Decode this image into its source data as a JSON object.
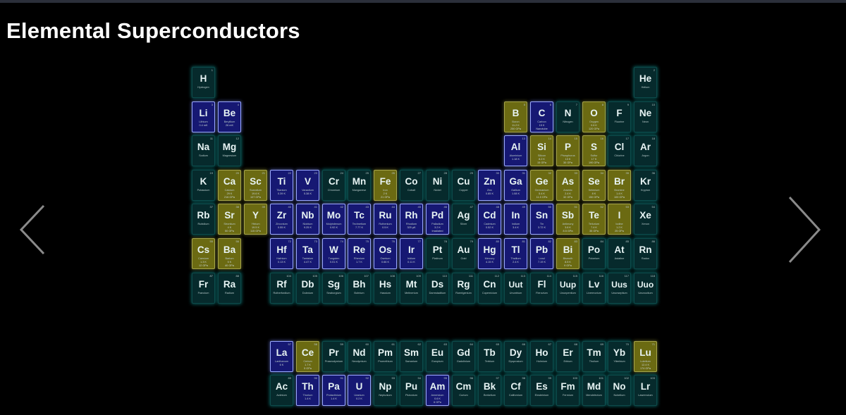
{
  "page": {
    "title": "Elemental Superconductors"
  },
  "nav": {
    "prev_icon": "chevron-left-icon",
    "next_icon": "chevron-right-icon"
  },
  "legend_colors": {
    "normal": "#062a2c",
    "superconductor_ambient": "#161873",
    "superconductor_pressure": "#6b6a12"
  },
  "elements": [
    {
      "n": 1,
      "s": "H",
      "name": "Hydrogen",
      "t": "normal",
      "row": 1,
      "col": 1
    },
    {
      "n": 2,
      "s": "He",
      "name": "Helium",
      "t": "normal",
      "row": 1,
      "col": 18
    },
    {
      "n": 3,
      "s": "Li",
      "name": "Lithium",
      "t": "blue",
      "tc": "0.4 mK",
      "row": 2,
      "col": 1
    },
    {
      "n": 4,
      "s": "Be",
      "name": "Beryllium",
      "t": "blue",
      "tc": "26 mK",
      "row": 2,
      "col": 2
    },
    {
      "n": 5,
      "s": "B",
      "name": "Boron",
      "t": "gold",
      "tc": "11.2 K",
      "p": "250 GPa",
      "row": 2,
      "col": 13
    },
    {
      "n": 6,
      "s": "C",
      "name": "Carbon",
      "t": "blue",
      "tc": "15 K",
      "p": "Nanotube",
      "row": 2,
      "col": 14
    },
    {
      "n": 7,
      "s": "N",
      "name": "Nitrogen",
      "t": "normal",
      "row": 2,
      "col": 15
    },
    {
      "n": 8,
      "s": "O",
      "name": "Oxygen",
      "t": "gold",
      "tc": "0.6 K",
      "p": "120 GPa",
      "row": 2,
      "col": 16
    },
    {
      "n": 9,
      "s": "F",
      "name": "Fluorine",
      "t": "normal",
      "row": 2,
      "col": 17
    },
    {
      "n": 10,
      "s": "Ne",
      "name": "Neon",
      "t": "normal",
      "row": 2,
      "col": 18
    },
    {
      "n": 11,
      "s": "Na",
      "name": "Sodium",
      "t": "normal",
      "row": 3,
      "col": 1
    },
    {
      "n": 12,
      "s": "Mg",
      "name": "Magnesium",
      "t": "normal",
      "row": 3,
      "col": 2
    },
    {
      "n": 13,
      "s": "Al",
      "name": "Aluminium",
      "t": "blue",
      "tc": "1.18 K",
      "row": 3,
      "col": 13
    },
    {
      "n": 14,
      "s": "Si",
      "name": "Silicon",
      "t": "gold",
      "tc": "8.2 K",
      "p": "15 GPa",
      "row": 3,
      "col": 14
    },
    {
      "n": 15,
      "s": "P",
      "name": "Phosphorus",
      "t": "gold",
      "tc": "13 K",
      "p": "30 GPa",
      "row": 3,
      "col": 15
    },
    {
      "n": 16,
      "s": "S",
      "name": "Sulfur",
      "t": "gold",
      "tc": "17 K",
      "p": "190 GPa",
      "row": 3,
      "col": 16
    },
    {
      "n": 17,
      "s": "Cl",
      "name": "Chlorine",
      "t": "normal",
      "row": 3,
      "col": 17
    },
    {
      "n": 18,
      "s": "Ar",
      "name": "Argon",
      "t": "normal",
      "row": 3,
      "col": 18
    },
    {
      "n": 19,
      "s": "K",
      "name": "Potassium",
      "t": "normal",
      "row": 4,
      "col": 1
    },
    {
      "n": 20,
      "s": "Ca",
      "name": "Calcium",
      "t": "gold",
      "tc": "29 K",
      "p": "216 GPa",
      "row": 4,
      "col": 2
    },
    {
      "n": 21,
      "s": "Sc",
      "name": "Scandium",
      "t": "gold",
      "tc": "19.6 K",
      "p": "107 GPa",
      "row": 4,
      "col": 3
    },
    {
      "n": 22,
      "s": "Ti",
      "name": "Titanium",
      "t": "blue",
      "tc": "0.39 K",
      "row": 4,
      "col": 4
    },
    {
      "n": 23,
      "s": "V",
      "name": "Vanadium",
      "t": "blue",
      "tc": "5.38 K",
      "row": 4,
      "col": 5
    },
    {
      "n": 24,
      "s": "Cr",
      "name": "Chromium",
      "t": "normal",
      "row": 4,
      "col": 6
    },
    {
      "n": 25,
      "s": "Mn",
      "name": "Manganese",
      "t": "normal",
      "row": 4,
      "col": 7
    },
    {
      "n": 26,
      "s": "Fe",
      "name": "Iron",
      "t": "gold",
      "tc": "2 K",
      "p": "21 GPa",
      "row": 4,
      "col": 8
    },
    {
      "n": 27,
      "s": "Co",
      "name": "Cobalt",
      "t": "normal",
      "row": 4,
      "col": 9
    },
    {
      "n": 28,
      "s": "Ni",
      "name": "Nickel",
      "t": "normal",
      "row": 4,
      "col": 10
    },
    {
      "n": 29,
      "s": "Cu",
      "name": "Copper",
      "t": "normal",
      "row": 4,
      "col": 11
    },
    {
      "n": 30,
      "s": "Zn",
      "name": "Zinc",
      "t": "blue",
      "tc": "0.85 K",
      "row": 4,
      "col": 12
    },
    {
      "n": 31,
      "s": "Ga",
      "name": "Gallium",
      "t": "blue",
      "tc": "1.08 K",
      "row": 4,
      "col": 13
    },
    {
      "n": 32,
      "s": "Ge",
      "name": "Germanium",
      "t": "gold",
      "tc": "5.4 K",
      "p": "11.5 GPa",
      "row": 4,
      "col": 14
    },
    {
      "n": 33,
      "s": "As",
      "name": "Arsenic",
      "t": "gold",
      "tc": "2.4 K",
      "p": "32 GPa",
      "row": 4,
      "col": 15
    },
    {
      "n": 34,
      "s": "Se",
      "name": "Selenium",
      "t": "gold",
      "tc": "8 K",
      "p": "150 GPa",
      "row": 4,
      "col": 16
    },
    {
      "n": 35,
      "s": "Br",
      "name": "Bromine",
      "t": "gold",
      "tc": "1.4 K",
      "p": "100 GPa",
      "row": 4,
      "col": 17
    },
    {
      "n": 36,
      "s": "Kr",
      "name": "Krypton",
      "t": "normal",
      "row": 4,
      "col": 18
    },
    {
      "n": 37,
      "s": "Rb",
      "name": "Rubidium",
      "t": "normal",
      "row": 5,
      "col": 1
    },
    {
      "n": 38,
      "s": "Sr",
      "name": "Strontium",
      "t": "gold",
      "tc": "4 K",
      "p": "50 GPa",
      "row": 5,
      "col": 2
    },
    {
      "n": 39,
      "s": "Y",
      "name": "Yttrium",
      "t": "gold",
      "tc": "19.5 K",
      "p": "115 GPa",
      "row": 5,
      "col": 3
    },
    {
      "n": 40,
      "s": "Zr",
      "name": "Zirconium",
      "t": "blue",
      "tc": "0.55 K",
      "row": 5,
      "col": 4
    },
    {
      "n": 41,
      "s": "Nb",
      "name": "Niobium",
      "t": "blue",
      "tc": "9.25 K",
      "row": 5,
      "col": 5
    },
    {
      "n": 42,
      "s": "Mo",
      "name": "Molybdenum",
      "t": "blue",
      "tc": "0.92 K",
      "row": 5,
      "col": 6
    },
    {
      "n": 43,
      "s": "Tc",
      "name": "Technetium",
      "t": "blue",
      "tc": "7.77 K",
      "row": 5,
      "col": 7
    },
    {
      "n": 44,
      "s": "Ru",
      "name": "Ruthenium",
      "t": "blue",
      "tc": "0.5 K",
      "row": 5,
      "col": 8
    },
    {
      "n": 45,
      "s": "Rh",
      "name": "Rhodium",
      "t": "blue",
      "tc": "325 µK",
      "row": 5,
      "col": 9
    },
    {
      "n": 46,
      "s": "Pd",
      "name": "Palladium",
      "t": "blue",
      "tc": "3.2 K",
      "p": "Irradiated",
      "row": 5,
      "col": 10
    },
    {
      "n": 47,
      "s": "Ag",
      "name": "Silver",
      "t": "normal",
      "row": 5,
      "col": 11
    },
    {
      "n": 48,
      "s": "Cd",
      "name": "Cadmium",
      "t": "blue",
      "tc": "0.52 K",
      "row": 5,
      "col": 12
    },
    {
      "n": 49,
      "s": "In",
      "name": "Indium",
      "t": "blue",
      "tc": "3.4 K",
      "row": 5,
      "col": 13
    },
    {
      "n": 50,
      "s": "Sn",
      "name": "Tin",
      "t": "blue",
      "tc": "3.72 K",
      "row": 5,
      "col": 14
    },
    {
      "n": 51,
      "s": "Sb",
      "name": "Antimony",
      "t": "gold",
      "tc": "3.6 K",
      "p": "8.5 GPa",
      "row": 5,
      "col": 15
    },
    {
      "n": 52,
      "s": "Te",
      "name": "Tellurium",
      "t": "gold",
      "tc": "7.4 K",
      "p": "35 GPa",
      "row": 5,
      "col": 16
    },
    {
      "n": 53,
      "s": "I",
      "name": "Iodine",
      "t": "gold",
      "tc": "1.2 K",
      "p": "25 GPa",
      "row": 5,
      "col": 17
    },
    {
      "n": 54,
      "s": "Xe",
      "name": "Xenon",
      "t": "normal",
      "row": 5,
      "col": 18
    },
    {
      "n": 55,
      "s": "Cs",
      "name": "Caesium",
      "t": "gold",
      "tc": "1.3 K",
      "p": "12 GPa",
      "row": 6,
      "col": 1
    },
    {
      "n": 56,
      "s": "Ba",
      "name": "Barium",
      "t": "gold",
      "tc": "5 K",
      "p": "40 GPa",
      "row": 6,
      "col": 2
    },
    {
      "n": 72,
      "s": "Hf",
      "name": "Hafnium",
      "t": "blue",
      "tc": "0.13 K",
      "row": 6,
      "col": 4
    },
    {
      "n": 73,
      "s": "Ta",
      "name": "Tantalum",
      "t": "blue",
      "tc": "4.47 K",
      "row": 6,
      "col": 5
    },
    {
      "n": 74,
      "s": "W",
      "name": "Tungsten",
      "t": "blue",
      "tc": "0.01 K",
      "row": 6,
      "col": 6
    },
    {
      "n": 75,
      "s": "Re",
      "name": "Rhenium",
      "t": "blue",
      "tc": "1.7 K",
      "row": 6,
      "col": 7
    },
    {
      "n": 76,
      "s": "Os",
      "name": "Osmium",
      "t": "blue",
      "tc": "0.66 K",
      "row": 6,
      "col": 8
    },
    {
      "n": 77,
      "s": "Ir",
      "name": "Iridium",
      "t": "blue",
      "tc": "0.11 K",
      "row": 6,
      "col": 9
    },
    {
      "n": 78,
      "s": "Pt",
      "name": "Platinum",
      "t": "normal",
      "row": 6,
      "col": 10
    },
    {
      "n": 79,
      "s": "Au",
      "name": "Gold",
      "t": "normal",
      "row": 6,
      "col": 11
    },
    {
      "n": 80,
      "s": "Hg",
      "name": "Mercury",
      "t": "blue",
      "tc": "4.15 K",
      "row": 6,
      "col": 12
    },
    {
      "n": 81,
      "s": "Tl",
      "name": "Thallium",
      "t": "blue",
      "tc": "2.4 K",
      "row": 6,
      "col": 13
    },
    {
      "n": 82,
      "s": "Pb",
      "name": "Lead",
      "t": "blue",
      "tc": "7.19 K",
      "row": 6,
      "col": 14
    },
    {
      "n": 83,
      "s": "Bi",
      "name": "Bismuth",
      "t": "gold",
      "tc": "8.5 K",
      "p": "9 GPa",
      "row": 6,
      "col": 15
    },
    {
      "n": 84,
      "s": "Po",
      "name": "Polonium",
      "t": "normal",
      "row": 6,
      "col": 16
    },
    {
      "n": 85,
      "s": "At",
      "name": "Astatine",
      "t": "normal",
      "row": 6,
      "col": 17
    },
    {
      "n": 86,
      "s": "Rn",
      "name": "Radon",
      "t": "normal",
      "row": 6,
      "col": 18
    },
    {
      "n": 87,
      "s": "Fr",
      "name": "Francium",
      "t": "normal",
      "row": 7,
      "col": 1
    },
    {
      "n": 88,
      "s": "Ra",
      "name": "Radium",
      "t": "normal",
      "row": 7,
      "col": 2
    },
    {
      "n": 104,
      "s": "Rf",
      "name": "Rutherfordium",
      "t": "normal",
      "row": 7,
      "col": 4
    },
    {
      "n": 105,
      "s": "Db",
      "name": "Dubnium",
      "t": "normal",
      "row": 7,
      "col": 5
    },
    {
      "n": 106,
      "s": "Sg",
      "name": "Seaborgium",
      "t": "normal",
      "row": 7,
      "col": 6
    },
    {
      "n": 107,
      "s": "Bh",
      "name": "Bohrium",
      "t": "normal",
      "row": 7,
      "col": 7
    },
    {
      "n": 108,
      "s": "Hs",
      "name": "Hassium",
      "t": "normal",
      "row": 7,
      "col": 8
    },
    {
      "n": 109,
      "s": "Mt",
      "name": "Meitnerium",
      "t": "normal",
      "row": 7,
      "col": 9
    },
    {
      "n": 110,
      "s": "Ds",
      "name": "Darmstadtium",
      "t": "normal",
      "row": 7,
      "col": 10
    },
    {
      "n": 111,
      "s": "Rg",
      "name": "Roentgenium",
      "t": "normal",
      "row": 7,
      "col": 11
    },
    {
      "n": 112,
      "s": "Cn",
      "name": "Copernicium",
      "t": "normal",
      "row": 7,
      "col": 12
    },
    {
      "n": 113,
      "s": "Uut",
      "name": "Ununtrium",
      "t": "normal",
      "row": 7,
      "col": 13
    },
    {
      "n": 114,
      "s": "Fl",
      "name": "Flerovium",
      "t": "normal",
      "row": 7,
      "col": 14
    },
    {
      "n": 115,
      "s": "Uup",
      "name": "Ununpentium",
      "t": "normal",
      "row": 7,
      "col": 15
    },
    {
      "n": 116,
      "s": "Lv",
      "name": "Livermorium",
      "t": "normal",
      "row": 7,
      "col": 16
    },
    {
      "n": 117,
      "s": "Uus",
      "name": "Ununseptium",
      "t": "normal",
      "row": 7,
      "col": 17
    },
    {
      "n": 118,
      "s": "Uuo",
      "name": "Ununoctium",
      "t": "normal",
      "row": 7,
      "col": 18
    },
    {
      "n": 57,
      "s": "La",
      "name": "Lanthanum",
      "t": "blue",
      "tc": "6 K",
      "row": 9,
      "col": 4
    },
    {
      "n": 58,
      "s": "Ce",
      "name": "Cerium",
      "t": "gold",
      "tc": "1.7 K",
      "p": "5 GPa",
      "row": 9,
      "col": 5
    },
    {
      "n": 59,
      "s": "Pr",
      "name": "Praseodymium",
      "t": "normal",
      "row": 9,
      "col": 6
    },
    {
      "n": 60,
      "s": "Nd",
      "name": "Neodymium",
      "t": "normal",
      "row": 9,
      "col": 7
    },
    {
      "n": 61,
      "s": "Pm",
      "name": "Promethium",
      "t": "normal",
      "row": 9,
      "col": 8
    },
    {
      "n": 62,
      "s": "Sm",
      "name": "Samarium",
      "t": "normal",
      "row": 9,
      "col": 9
    },
    {
      "n": 63,
      "s": "Eu",
      "name": "Europium",
      "t": "normal",
      "row": 9,
      "col": 10
    },
    {
      "n": 64,
      "s": "Gd",
      "name": "Gadolinium",
      "t": "normal",
      "row": 9,
      "col": 11
    },
    {
      "n": 65,
      "s": "Tb",
      "name": "Terbium",
      "t": "normal",
      "row": 9,
      "col": 12
    },
    {
      "n": 66,
      "s": "Dy",
      "name": "Dysprosium",
      "t": "normal",
      "row": 9,
      "col": 13
    },
    {
      "n": 67,
      "s": "Ho",
      "name": "Holmium",
      "t": "normal",
      "row": 9,
      "col": 14
    },
    {
      "n": 68,
      "s": "Er",
      "name": "Erbium",
      "t": "normal",
      "row": 9,
      "col": 15
    },
    {
      "n": 69,
      "s": "Tm",
      "name": "Thulium",
      "t": "normal",
      "row": 9,
      "col": 16
    },
    {
      "n": 70,
      "s": "Yb",
      "name": "Ytterbium",
      "t": "normal",
      "row": 9,
      "col": 17
    },
    {
      "n": 71,
      "s": "Lu",
      "name": "Lutetium",
      "t": "gold",
      "tc": "12.4 K",
      "p": "174 GPa",
      "row": 9,
      "col": 18
    },
    {
      "n": 89,
      "s": "Ac",
      "name": "Actinium",
      "t": "normal",
      "row": 10,
      "col": 4
    },
    {
      "n": 90,
      "s": "Th",
      "name": "Thorium",
      "t": "blue",
      "tc": "1.4 K",
      "row": 10,
      "col": 5
    },
    {
      "n": 91,
      "s": "Pa",
      "name": "Protactinium",
      "t": "blue",
      "tc": "1.4 K",
      "row": 10,
      "col": 6
    },
    {
      "n": 92,
      "s": "U",
      "name": "Uranium",
      "t": "blue",
      "tc": "0.2 K",
      "row": 10,
      "col": 7
    },
    {
      "n": 93,
      "s": "Np",
      "name": "Neptunium",
      "t": "normal",
      "row": 10,
      "col": 8
    },
    {
      "n": 94,
      "s": "Pu",
      "name": "Plutonium",
      "t": "normal",
      "row": 10,
      "col": 9
    },
    {
      "n": 95,
      "s": "Am",
      "name": "Americium",
      "t": "blue",
      "tc": "0.6 K",
      "p": "6 GPa",
      "row": 10,
      "col": 10
    },
    {
      "n": 96,
      "s": "Cm",
      "name": "Curium",
      "t": "normal",
      "row": 10,
      "col": 11
    },
    {
      "n": 97,
      "s": "Bk",
      "name": "Berkelium",
      "t": "normal",
      "row": 10,
      "col": 12
    },
    {
      "n": 98,
      "s": "Cf",
      "name": "Californium",
      "t": "normal",
      "row": 10,
      "col": 13
    },
    {
      "n": 99,
      "s": "Es",
      "name": "Einsteinium",
      "t": "normal",
      "row": 10,
      "col": 14
    },
    {
      "n": 100,
      "s": "Fm",
      "name": "Fermium",
      "t": "normal",
      "row": 10,
      "col": 15
    },
    {
      "n": 101,
      "s": "Md",
      "name": "Mendelevium",
      "t": "normal",
      "row": 10,
      "col": 16
    },
    {
      "n": 102,
      "s": "No",
      "name": "Nobelium",
      "t": "normal",
      "row": 10,
      "col": 17
    },
    {
      "n": 103,
      "s": "Lr",
      "name": "Lawrencium",
      "t": "normal",
      "row": 10,
      "col": 18
    }
  ]
}
